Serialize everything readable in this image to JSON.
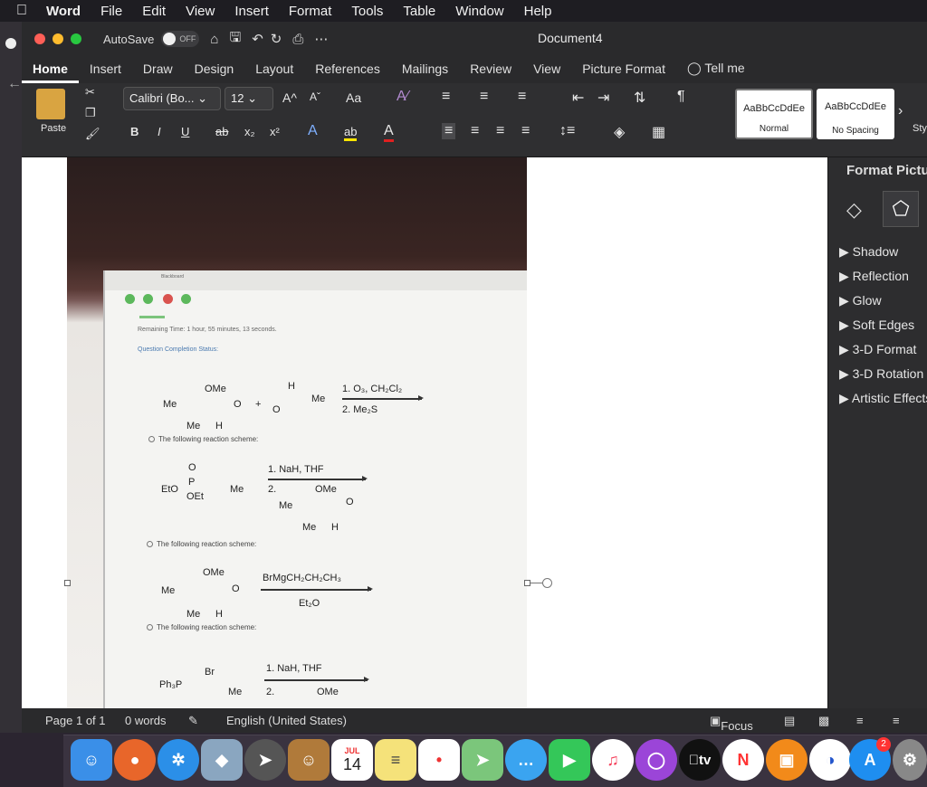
{
  "menubar": {
    "apple": "",
    "app": "Word",
    "items": [
      "File",
      "Edit",
      "View",
      "Insert",
      "Format",
      "Tools",
      "Table",
      "Window",
      "Help"
    ]
  },
  "titlebar": {
    "autosave": "AutoSave",
    "toggle": "OFF",
    "doc_title": "Document4"
  },
  "tabs": [
    "Home",
    "Insert",
    "Draw",
    "Design",
    "Layout",
    "References",
    "Mailings",
    "Review",
    "View",
    "Picture Format",
    "Tell me"
  ],
  "ribbon": {
    "paste": "Paste",
    "font_name": "Calibri (Bo...",
    "font_size": "12",
    "grow_font": "A^",
    "shrink_font": "Aˇ",
    "change_case": "Aa",
    "bold": "B",
    "italic": "I",
    "underline": "U",
    "strike": "ab",
    "subscript": "x₂",
    "superscript": "x²",
    "text_effects": "A",
    "highlight": "ab",
    "font_color": "A",
    "styles": [
      {
        "sample": "AaBbCcDdEe",
        "name": "Normal"
      },
      {
        "sample": "AaBbCcDdEe",
        "name": "No Spacing"
      }
    ],
    "styles_pane": "Styles Pane"
  },
  "photo": {
    "window_tab": "Blackboard",
    "remaining_time": "Remaining Time: 1 hour, 55 minutes, 13 seconds.",
    "completion": "Question Completion Status:",
    "reactions": [
      {
        "reagents": [
          "1. O₃, CH₂Cl₂",
          "2. Me₂S"
        ],
        "option": "The following reaction scheme:"
      },
      {
        "reagents": [
          "1. NaH, THF",
          "2."
        ],
        "option": "The following reaction scheme:"
      },
      {
        "reagents": [
          "BrMgCH₂CH₂CH₃",
          "Et₂O"
        ],
        "option": "The following reaction scheme:"
      },
      {
        "reagents": [
          "1. NaH, THF",
          "2."
        ],
        "option": ""
      }
    ],
    "labels": {
      "ome": "OMe",
      "me": "Me",
      "h": "H",
      "eto": "EtO",
      "oet": "OEt",
      "p": "P",
      "ph3p": "Ph₃P",
      "br": "Br",
      "o": "O",
      "plus": "+"
    }
  },
  "format_pane": {
    "title": "Format Picture",
    "items": [
      "Shadow",
      "Reflection",
      "Glow",
      "Soft Edges",
      "3-D Format",
      "3-D Rotation",
      "Artistic Effects"
    ]
  },
  "statusbar": {
    "page": "Page 1 of 1",
    "words": "0 words",
    "language": "English (United States)",
    "focus": "Focus"
  },
  "dock": {
    "calendar_month": "JUL",
    "calendar_day": "14",
    "tv": "tv",
    "badge": "2"
  }
}
